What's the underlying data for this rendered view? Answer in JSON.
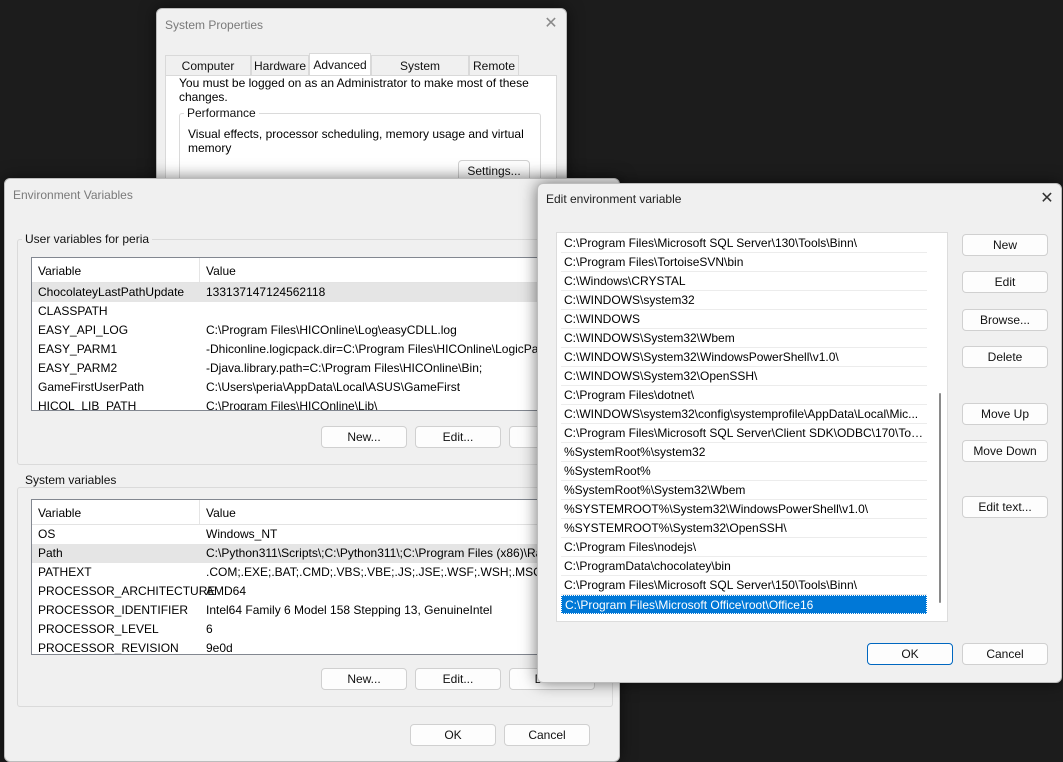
{
  "system_properties": {
    "title": "System Properties",
    "tabs": [
      "Computer Name",
      "Hardware",
      "Advanced",
      "System Protection",
      "Remote"
    ],
    "admin_note": "You must be logged on as an Administrator to make most of these changes.",
    "performance_label": "Performance",
    "performance_desc": "Visual effects, processor scheduling, memory usage and virtual memory",
    "settings_button": "Settings..."
  },
  "env_vars": {
    "title": "Environment Variables",
    "user_group_label": "User variables for peria",
    "col_variable": "Variable",
    "col_value": "Value",
    "user_rows": [
      {
        "name": "ChocolateyLastPathUpdate",
        "value": "133137147124562118"
      },
      {
        "name": "CLASSPATH",
        "value": ""
      },
      {
        "name": "EASY_API_LOG",
        "value": "C:\\Program Files\\HICOnline\\Log\\easyCDLL.log"
      },
      {
        "name": "EASY_PARM1",
        "value": "-Dhiconline.logicpack.dir=C:\\Program Files\\HICOnline\\LogicPa"
      },
      {
        "name": "EASY_PARM2",
        "value": "-Djava.library.path=C:\\Program Files\\HICOnline\\Bin;"
      },
      {
        "name": "GameFirstUserPath",
        "value": "C:\\Users\\peria\\AppData\\Local\\ASUS\\GameFirst"
      },
      {
        "name": "HICOL_LIB_PATH",
        "value": "C:\\Program Files\\HICOnline\\Lib\\"
      }
    ],
    "user_new": "New...",
    "user_edit": "Edit...",
    "user_delete_partial": "D",
    "system_group_label": "System variables",
    "system_rows": [
      {
        "name": "OS",
        "value": "Windows_NT"
      },
      {
        "name": "Path",
        "value": "C:\\Python311\\Scripts\\;C:\\Python311\\;C:\\Program Files (x86)\\Ra"
      },
      {
        "name": "PATHEXT",
        "value": ".COM;.EXE;.BAT;.CMD;.VBS;.VBE;.JS;.JSE;.WSF;.WSH;.MSC;.PY;.PY"
      },
      {
        "name": "PROCESSOR_ARCHITECTURE",
        "value": "AMD64"
      },
      {
        "name": "PROCESSOR_IDENTIFIER",
        "value": "Intel64 Family 6 Model 158 Stepping 13, GenuineIntel"
      },
      {
        "name": "PROCESSOR_LEVEL",
        "value": "6"
      },
      {
        "name": "PROCESSOR_REVISION",
        "value": "9e0d"
      }
    ],
    "sys_new": "New...",
    "sys_edit": "Edit...",
    "sys_delete_partial": "Delete",
    "ok": "OK",
    "cancel": "Cancel"
  },
  "edit_env": {
    "title": "Edit environment variable",
    "paths": [
      "C:\\Program Files\\Microsoft SQL Server\\130\\Tools\\Binn\\",
      "C:\\Program Files\\TortoiseSVN\\bin",
      "C:\\Windows\\CRYSTAL",
      "C:\\WINDOWS\\system32",
      "C:\\WINDOWS",
      "C:\\WINDOWS\\System32\\Wbem",
      "C:\\WINDOWS\\System32\\WindowsPowerShell\\v1.0\\",
      "C:\\WINDOWS\\System32\\OpenSSH\\",
      "C:\\Program Files\\dotnet\\",
      "C:\\WINDOWS\\system32\\config\\systemprofile\\AppData\\Local\\Mic...",
      "C:\\Program Files\\Microsoft SQL Server\\Client SDK\\ODBC\\170\\Tool...",
      "%SystemRoot%\\system32",
      "%SystemRoot%",
      "%SystemRoot%\\System32\\Wbem",
      "%SYSTEMROOT%\\System32\\WindowsPowerShell\\v1.0\\",
      "%SYSTEMROOT%\\System32\\OpenSSH\\",
      "C:\\Program Files\\nodejs\\",
      "C:\\ProgramData\\chocolatey\\bin",
      "C:\\Program Files\\Microsoft SQL Server\\150\\Tools\\Binn\\",
      "C:\\Program Files\\Microsoft Office\\root\\Office16"
    ],
    "selected_index": 19,
    "buttons": {
      "new": "New",
      "edit": "Edit",
      "browse": "Browse...",
      "delete": "Delete",
      "move_up": "Move Up",
      "move_down": "Move Down",
      "edit_text": "Edit text..."
    },
    "ok": "OK",
    "cancel": "Cancel"
  }
}
